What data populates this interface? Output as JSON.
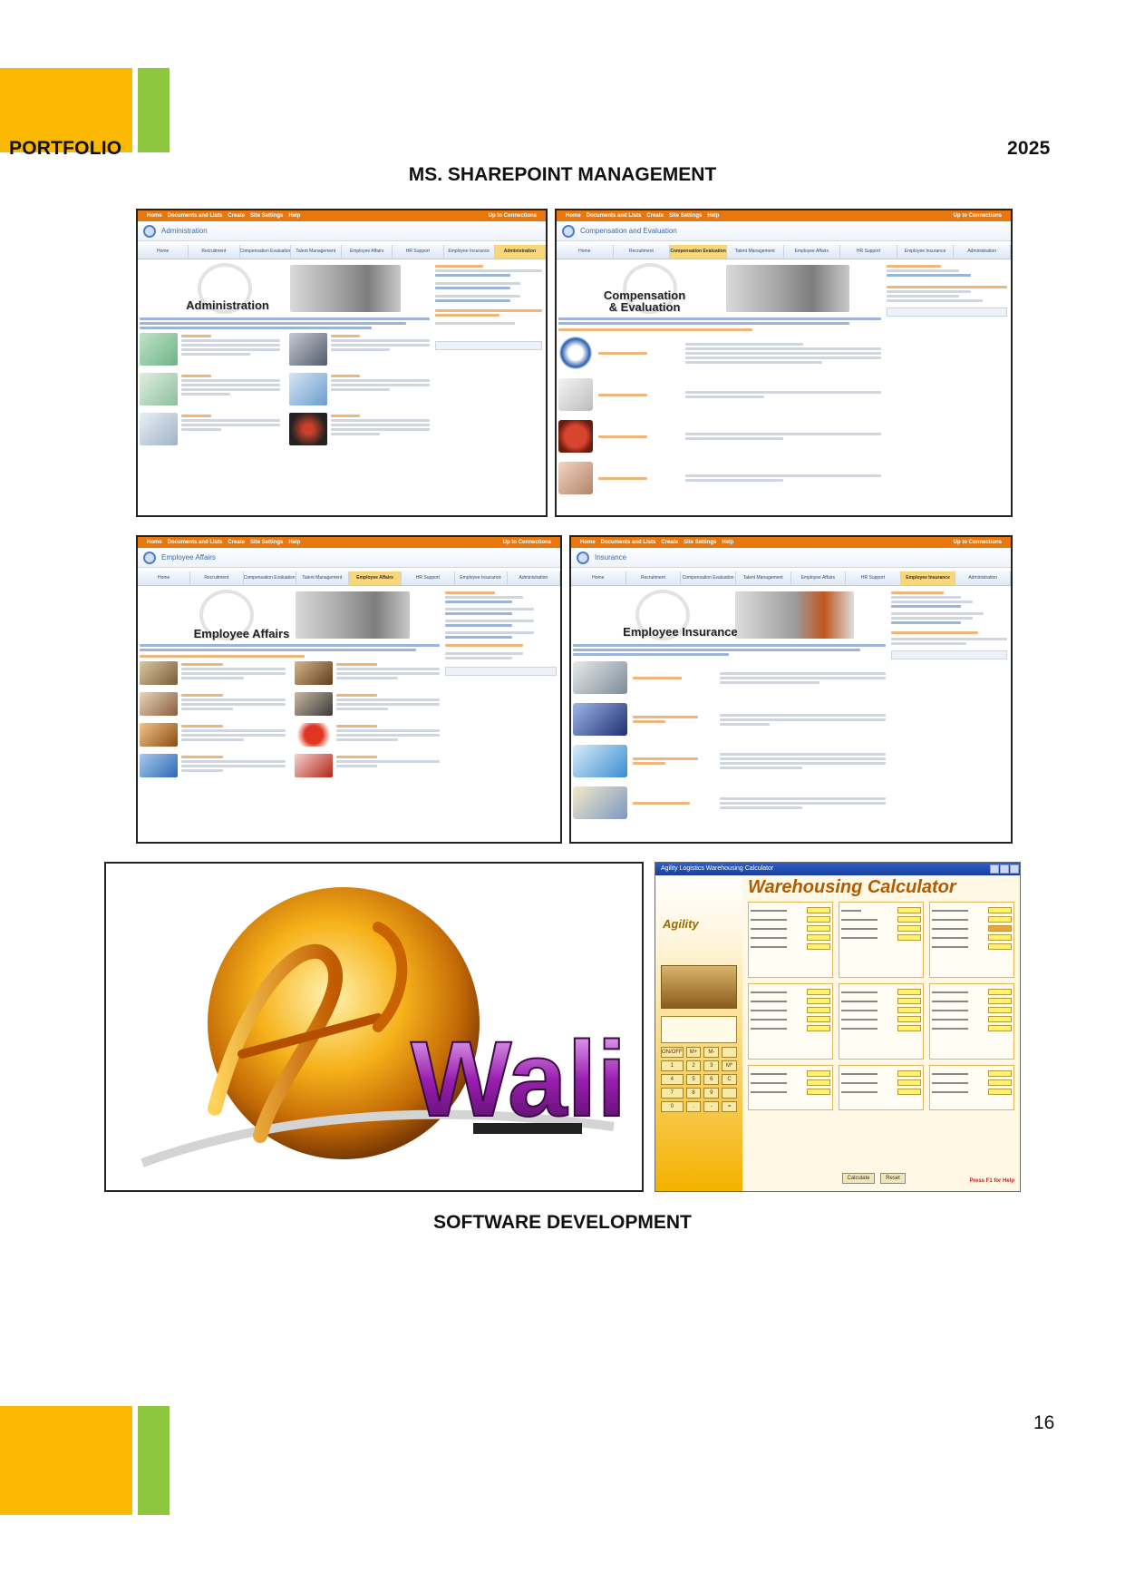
{
  "header": {
    "left_label": "PORTFOLIO",
    "year": "2025"
  },
  "sections": {
    "sharepoint_title": "MS. SHAREPOINT MANAGEMENT",
    "software_title": "SOFTWARE DEVELOPMENT"
  },
  "screenshots": {
    "admin": {
      "page_title": "Administration",
      "banner": "Administration",
      "active_tab": "Administration"
    },
    "comp": {
      "page_title": "Compensation and Evaluation",
      "banner_l1": "Compensation",
      "banner_l2": "& Evaluation",
      "active_tab": "Compensation Evaluation"
    },
    "emp": {
      "page_title": "Employee Affairs",
      "banner": "Employee Affairs",
      "active_tab": "Employee Affairs"
    },
    "ins": {
      "page_title": "Insurance",
      "banner": "Employee Insurance",
      "active_tab": "Employee Insurance"
    },
    "nav_tabs": [
      "Home",
      "Recruitment",
      "Compensation Evaluation",
      "Talent Management",
      "Employee Affairs",
      "HR Support",
      "Employee Insurance",
      "Administration"
    ],
    "topbar_items": [
      "Home",
      "Documents and Lists",
      "Create",
      "Site Settings",
      "Help"
    ],
    "topbar_right": "Up to Connections"
  },
  "calculator": {
    "window_title": "Agility Logistics Warehousing Calculator",
    "title": "Warehousing Calculator",
    "brand": "Agility",
    "keys": [
      "ON/OFF",
      "M+",
      "M-",
      "",
      "1",
      "2",
      "3",
      "M*",
      "4",
      "5",
      "6",
      "C",
      "7",
      "8",
      "9",
      "",
      "0",
      ".",
      "-",
      "="
    ],
    "btn_calculate": "Calculate",
    "btn_reset": "Reset",
    "help": "Press F1 for Help"
  },
  "logo": {
    "text": "Wali"
  },
  "page_number": "16",
  "colors": {
    "accent_yellow": "#fbb800",
    "accent_green": "#8dc63f",
    "sharepoint_orange": "#e8780e"
  }
}
